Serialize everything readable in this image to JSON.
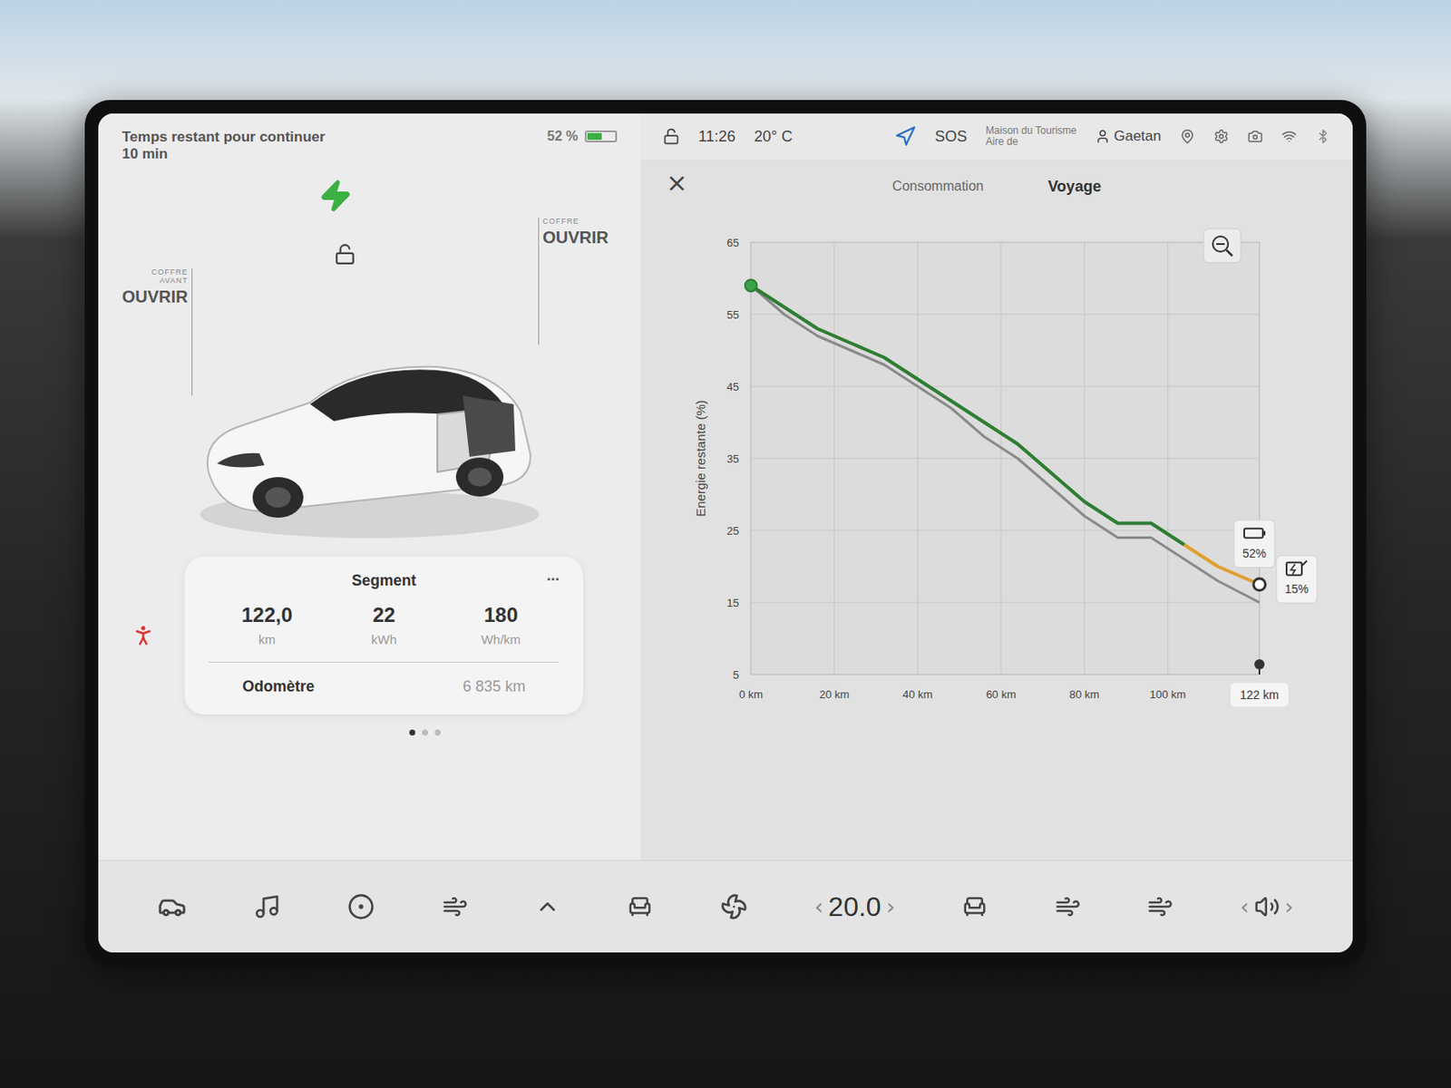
{
  "status": {
    "message": "Temps restant pour continuer",
    "time_left": "10 min",
    "battery": "52 %",
    "battery_level": 0.52,
    "charging": true,
    "clock": "11:26",
    "temperature": "20° C",
    "sos": "SOS",
    "location": "Maison du Tourisme",
    "location_sub": "Aire de",
    "user": "Gaetan",
    "locked": false
  },
  "car": {
    "frunk_label": "COFFRE AVANT",
    "frunk_action": "OUVRIR",
    "trunk_label": "COFFRE",
    "trunk_action": "OUVRIR",
    "locked": false,
    "seatbelt_warning": true
  },
  "trip_card": {
    "title": "Segment",
    "more": "...",
    "stats": [
      {
        "value": "122,0",
        "unit": "km"
      },
      {
        "value": "22",
        "unit": "kWh"
      },
      {
        "value": "180",
        "unit": "Wh/km"
      }
    ],
    "odometer_label": "Odomètre",
    "odometer": "6 835 km"
  },
  "pages": [
    {
      "selected": true
    },
    {
      "selected": false
    },
    {
      "selected": false
    }
  ],
  "panel": {
    "close": "×",
    "tabs": [
      {
        "label": "Consommation",
        "selected": false
      },
      {
        "label": "Voyage",
        "selected": true
      }
    ]
  },
  "chart": {
    "y_label": "Energie restante (%)",
    "y_min": 5,
    "y_max": 65,
    "x_max": 122,
    "y_ticks": [
      "65",
      "55",
      "45",
      "35",
      "25",
      "15",
      "5"
    ],
    "x_ticks": [
      "0 km",
      "20 km",
      "40 km",
      "60 km",
      "80 km",
      "100 km",
      "122 km"
    ],
    "series": [
      {
        "name": "predicted",
        "color": "#8a8a8a",
        "x_km": [
          0,
          8,
          16,
          24,
          32,
          40,
          48,
          56,
          64,
          72,
          80,
          88,
          96,
          104,
          112,
          122
        ],
        "values": [
          59,
          55,
          52,
          50,
          48,
          45,
          42,
          38,
          35,
          31,
          27,
          24,
          24,
          21,
          18,
          15
        ]
      },
      {
        "name": "actual",
        "color": "#2e7d32",
        "x_km": [
          0,
          8,
          16,
          24,
          32,
          40,
          48,
          56,
          64,
          72,
          80,
          88,
          96,
          104
        ],
        "values": [
          59,
          56,
          53,
          51,
          49,
          46,
          43,
          40,
          37,
          33,
          29,
          26,
          26,
          23
        ]
      },
      {
        "name": "projection",
        "color": "#e0a030",
        "x_km": [
          104,
          112,
          122
        ],
        "values": [
          23,
          20,
          17.5
        ]
      }
    ],
    "badges": [
      {
        "label": "52%",
        "kind": "battery"
      },
      {
        "label": "15%",
        "kind": "charger"
      }
    ]
  },
  "bottom_bar": {
    "temperature": "20.0",
    "temp_down": "‹",
    "temp_up": "›",
    "volume_down": "‹",
    "volume_up": "›"
  }
}
